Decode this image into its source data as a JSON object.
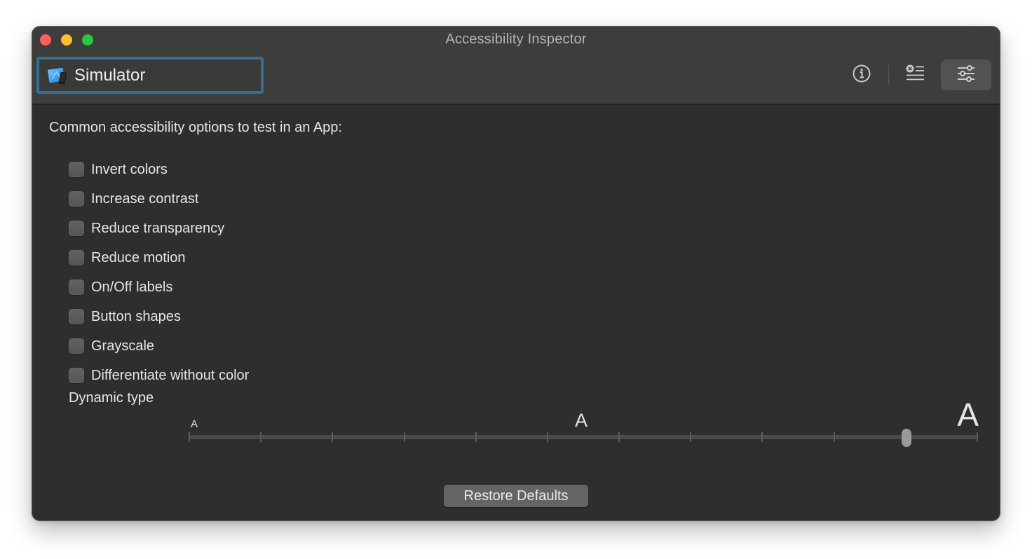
{
  "window": {
    "title": "Accessibility Inspector"
  },
  "toolbar": {
    "target": {
      "label": "Simulator",
      "icon": "xcode-simulator-app-icon"
    },
    "buttons": [
      {
        "name": "inspection",
        "icon": "info-circle-icon",
        "selected": false
      },
      {
        "name": "audit",
        "icon": "audit-list-icon",
        "selected": false
      },
      {
        "name": "settings",
        "icon": "sliders-icon",
        "selected": true
      }
    ]
  },
  "content": {
    "heading": "Common accessibility options to test in an App:",
    "options": [
      {
        "label": "Invert colors",
        "checked": false
      },
      {
        "label": "Increase contrast",
        "checked": false
      },
      {
        "label": "Reduce transparency",
        "checked": false
      },
      {
        "label": "Reduce motion",
        "checked": false
      },
      {
        "label": "On/Off labels",
        "checked": false
      },
      {
        "label": "Button shapes",
        "checked": false
      },
      {
        "label": "Grayscale",
        "checked": false
      },
      {
        "label": "Differentiate without color",
        "checked": false
      }
    ],
    "dynamic_type": {
      "label": "Dynamic type",
      "small_glyph": "A",
      "mid_glyph": "A",
      "large_glyph": "A",
      "steps": 12,
      "selected_index": 10
    },
    "restore_button": "Restore Defaults"
  }
}
